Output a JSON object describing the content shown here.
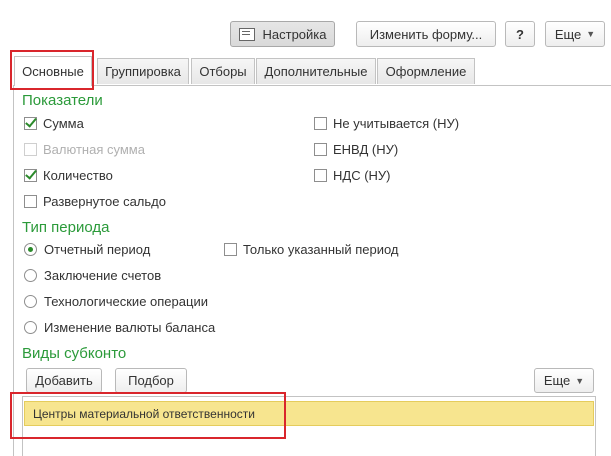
{
  "toolbar": {
    "settings_label": "Настройка",
    "change_form_label": "Изменить форму...",
    "help_label": "?",
    "more_label": "Еще"
  },
  "tabs": [
    {
      "label": "Основные",
      "active": true
    },
    {
      "label": "Группировка",
      "active": false
    },
    {
      "label": "Отборы",
      "active": false
    },
    {
      "label": "Дополнительные",
      "active": false
    },
    {
      "label": "Оформление",
      "active": false
    }
  ],
  "indicators": {
    "title": "Показатели",
    "left": [
      {
        "label": "Сумма",
        "checked": true,
        "disabled": false
      },
      {
        "label": "Валютная сумма",
        "checked": false,
        "disabled": true
      },
      {
        "label": "Количество",
        "checked": true,
        "disabled": false
      },
      {
        "label": "Развернутое сальдо",
        "checked": false,
        "disabled": false
      }
    ],
    "right": [
      {
        "label": "Не учитывается (НУ)",
        "checked": false
      },
      {
        "label": "ЕНВД (НУ)",
        "checked": false
      },
      {
        "label": "НДС (НУ)",
        "checked": false
      }
    ]
  },
  "period": {
    "title": "Тип периода",
    "options": [
      {
        "label": "Отчетный период",
        "selected": true
      },
      {
        "label": "Заключение счетов",
        "selected": false
      },
      {
        "label": "Технологические операции",
        "selected": false
      },
      {
        "label": "Изменение валюты баланса",
        "selected": false
      }
    ],
    "only_period_label": "Только указанный период",
    "only_period_checked": false
  },
  "subconto": {
    "title": "Виды субконто",
    "add_label": "Добавить",
    "pick_label": "Подбор",
    "more_label": "Еще",
    "rows": [
      "Центры материальной ответственности"
    ]
  },
  "colors": {
    "section_title": "#2b9a3a",
    "checkmark": "#2b8a2b",
    "highlight_row": "#f7e58f",
    "annotation_red": "#d9262c"
  }
}
